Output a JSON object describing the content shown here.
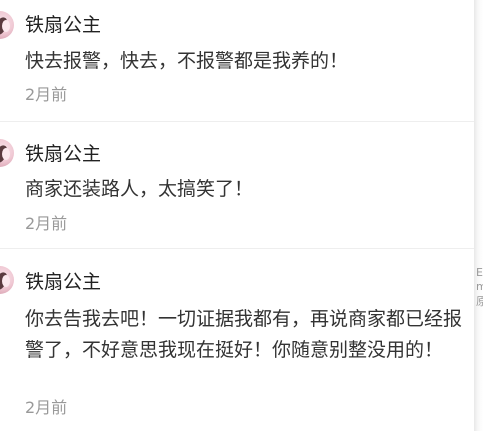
{
  "comments": [
    {
      "author": "铁扇公主",
      "text": "快去报警，快去，不报警都是我养的！",
      "time": "2月前"
    },
    {
      "author": "铁扇公主",
      "text": "商家还装路人，太搞笑了！",
      "time": "2月前"
    },
    {
      "author": "铁扇公主",
      "text": "你去告我去吧！一切证据我都有，再说商家都已经报警了，不好意思我现在挺好！你随意别整没用的！",
      "time": "2月前"
    }
  ],
  "edge_fragments": [
    "E",
    "m",
    "原"
  ],
  "colors": {
    "author": "#222222",
    "text": "#333333",
    "time": "#999999",
    "divider": "#eeeeee"
  }
}
